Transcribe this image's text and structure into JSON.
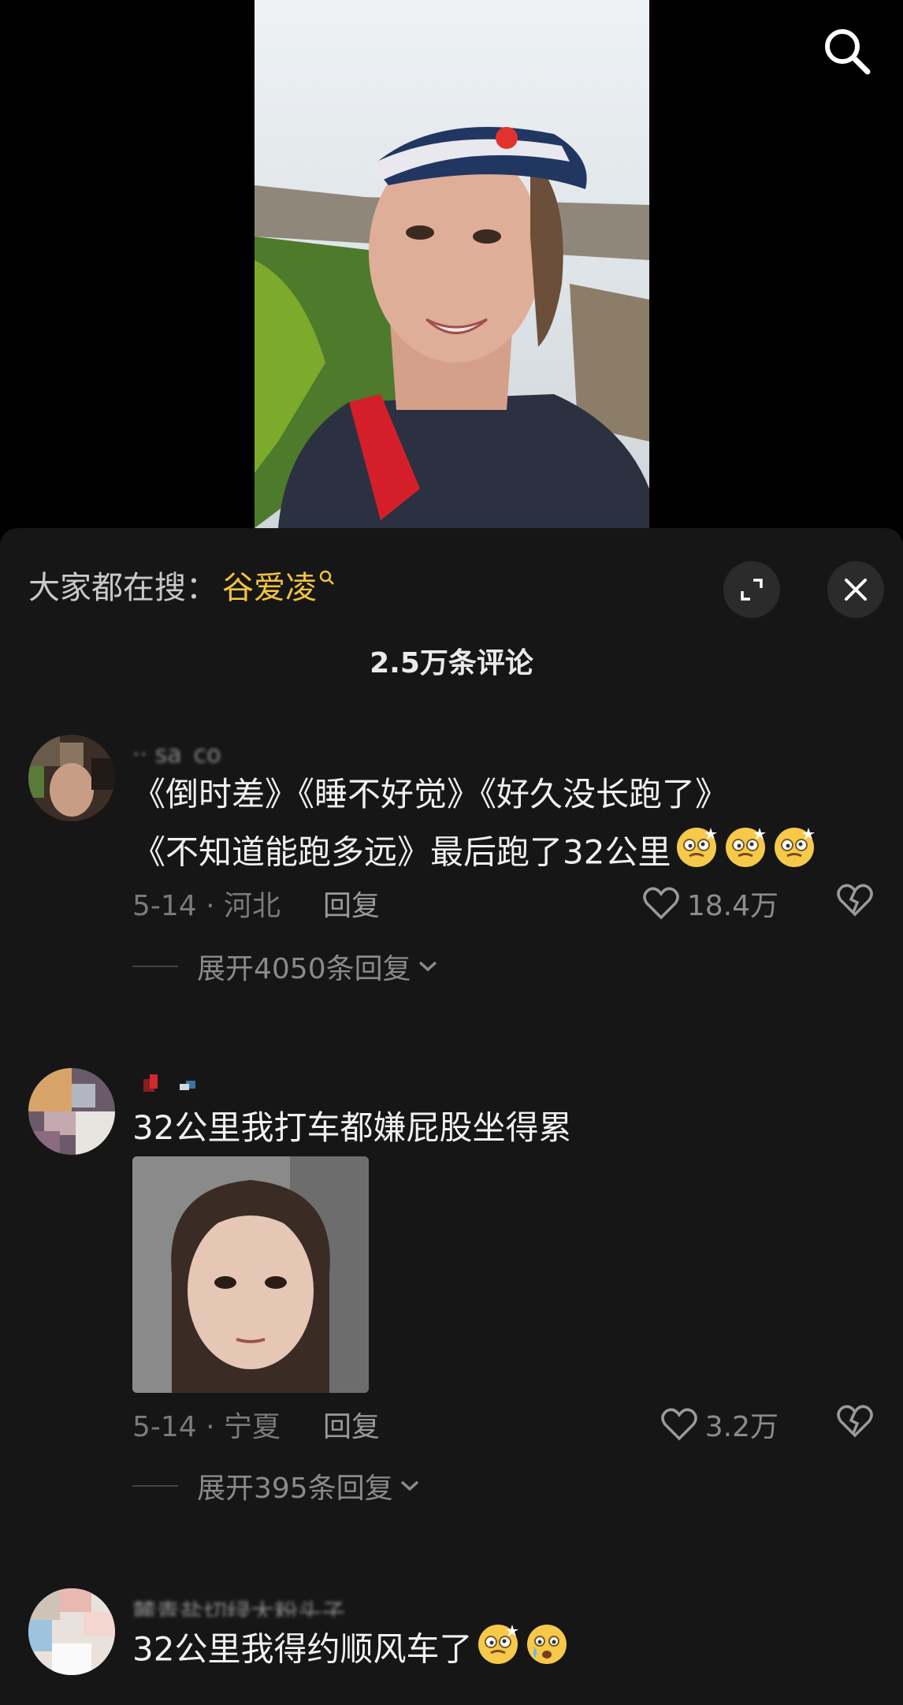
{
  "video": {
    "search_icon": "search-icon"
  },
  "panel": {
    "hot_search_label": "大家都在搜：",
    "hot_search_term": "谷爱凌",
    "comment_count": "2.5万条评论"
  },
  "comments": [
    {
      "username": "·· sa_co",
      "text_line1": "《倒时差》《睡不好觉》《好久没长跑了》",
      "text_line2": "《不知道能跑多远》最后跑了32公里",
      "date_loc": "5-14 · 河北",
      "reply_label": "回复",
      "likes": "18.4万",
      "expand_label": "展开4050条回复"
    },
    {
      "username": "",
      "text": "32公里我打车都嫌屁股坐得累",
      "date_loc": "5-14 · 宁夏",
      "reply_label": "回复",
      "likes": "3.2万",
      "expand_label": "展开395条回复"
    },
    {
      "username": "麓青盐切绿大粉头子",
      "text": "32公里我得约顺风车了"
    }
  ],
  "colors": {
    "accent": "#f3c33c",
    "panel_bg": "#161616",
    "button_bg": "#2b2b2b"
  }
}
